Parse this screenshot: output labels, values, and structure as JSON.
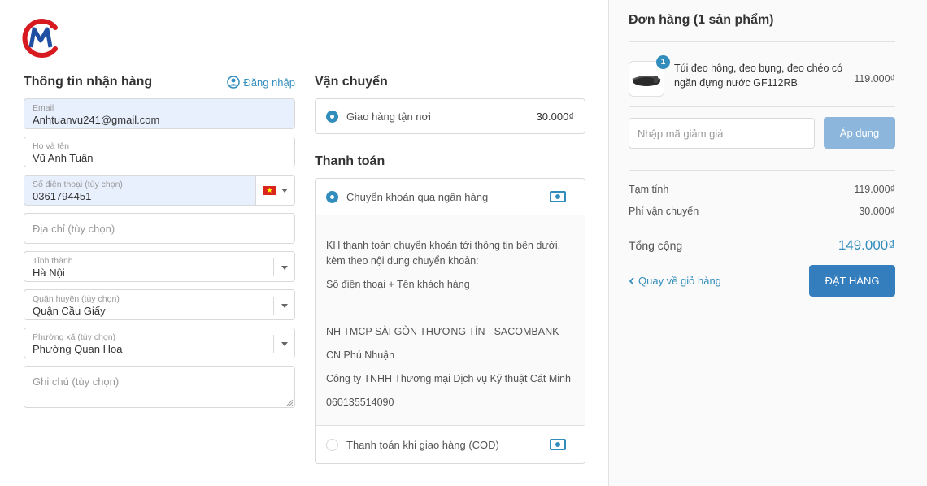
{
  "colors": {
    "accent": "#338dbc",
    "order_button": "#357ebd",
    "apply_button": "#8cb6dc"
  },
  "shipping_info": {
    "title": "Thông tin nhận hàng",
    "login_label": "Đăng nhập",
    "email": {
      "label": "Email",
      "value": "Anhtuanvu241@gmail.com"
    },
    "name": {
      "label": "Họ và tên",
      "value": "Vũ Anh Tuấn"
    },
    "phone": {
      "label": "Số điện thoại (tùy chọn)",
      "value": "0361794451",
      "flag_icon": "vietnam-flag-icon"
    },
    "address": {
      "placeholder": "Địa chỉ (tùy chọn)"
    },
    "province": {
      "label": "Tỉnh thành",
      "value": "Hà Nội"
    },
    "district": {
      "label": "Quận huyện (tùy chọn)",
      "value": "Quận Cầu Giấy"
    },
    "ward": {
      "label": "Phường xã (tùy chọn)",
      "value": "Phường Quan Hoa"
    },
    "note": {
      "placeholder": "Ghi chú (tùy chọn)"
    }
  },
  "shipping": {
    "title": "Vận chuyển",
    "option": {
      "label": "Giao hàng tận nơi",
      "price": "30.000₫"
    }
  },
  "payment": {
    "title": "Thanh toán",
    "bank": {
      "label": "Chuyển khoản qua ngân hàng",
      "instructions": "KH thanh toán chuyển khoản tới thông tin bên dưới, kèm theo nội dung chuyển khoản:",
      "content": "Số điện thoại + Tên khách hàng",
      "bank_name": "NH TMCP SÀI GÒN THƯƠNG TÍN - SACOMBANK",
      "branch": "CN Phú Nhuận",
      "company": "Công ty TNHH Thương mại Dịch vụ Kỹ thuật Cát Minh",
      "account": "060135514090"
    },
    "cod": {
      "label": "Thanh toán khi giao hàng (COD)"
    }
  },
  "order": {
    "title": "Đơn hàng (1 sản phẩm)",
    "product": {
      "name": "Túi đeo hông, đeo bụng, đeo chéo có ngăn đựng nước GF112RB",
      "price": "119.000₫",
      "quantity": "1"
    },
    "discount": {
      "placeholder": "Nhập mã giảm giá",
      "apply_label": "Áp dụng"
    },
    "subtotal": {
      "label": "Tạm tính",
      "value": "119.000₫"
    },
    "shipping_fee": {
      "label": "Phí vận chuyển",
      "value": "30.000₫"
    },
    "total": {
      "label": "Tổng cộng",
      "value": "149.000₫"
    },
    "back_label": "Quay về giỏ hàng",
    "place_order_label": "ĐẶT HÀNG"
  }
}
